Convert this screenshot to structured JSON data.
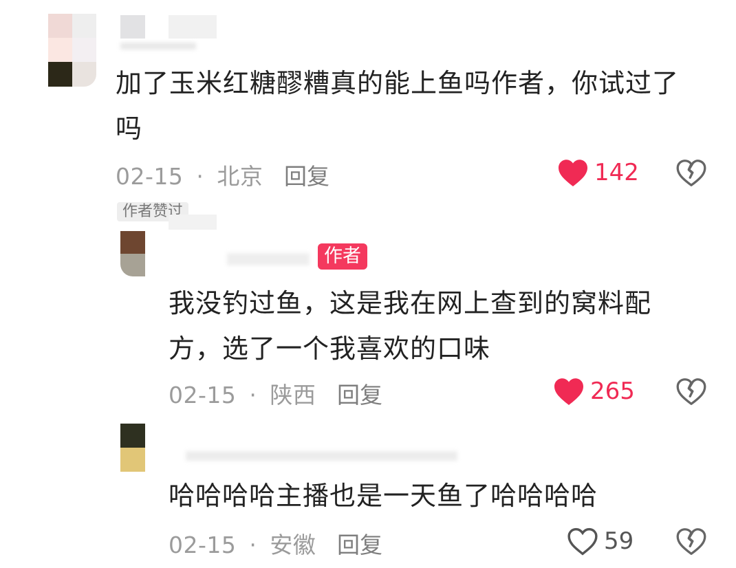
{
  "comments": [
    {
      "text": "加了玉米红糖醪糟真的能上鱼吗作者，你试过了吗",
      "text_line1": "加了玉米红糖醪糟真的能上鱼吗作者，你试过了",
      "text_line2": "吗",
      "date": "02-15",
      "location": "北京",
      "reply_label": "回复",
      "likes": "142",
      "liked": true,
      "author_liked_tag": "作者赞过"
    },
    {
      "author_badge": "作者",
      "text": "我没钓过鱼，这是我在网上查到的窝料配方，选了一个我喜欢的口味",
      "text_line1": "我没钓过鱼，这是我在网上查到的窝料配",
      "text_line2": "方，选了一个我喜欢的口味",
      "date": "02-15",
      "location": "陕西",
      "reply_label": "回复",
      "likes": "265",
      "liked": true
    },
    {
      "text": "哈哈哈哈主播也是一天鱼了哈哈哈哈",
      "date": "02-15",
      "location": "安徽",
      "reply_label": "回复",
      "likes": "59",
      "liked": false
    }
  ],
  "separator": "·",
  "icons": {
    "like_filled": "heart-filled-icon",
    "like_outline": "heart-outline-icon",
    "dislike": "broken-heart-icon"
  },
  "colors": {
    "like_red": "#f02a54",
    "author_badge": "#f4395e",
    "meta_gray": "#9b9b9b"
  }
}
